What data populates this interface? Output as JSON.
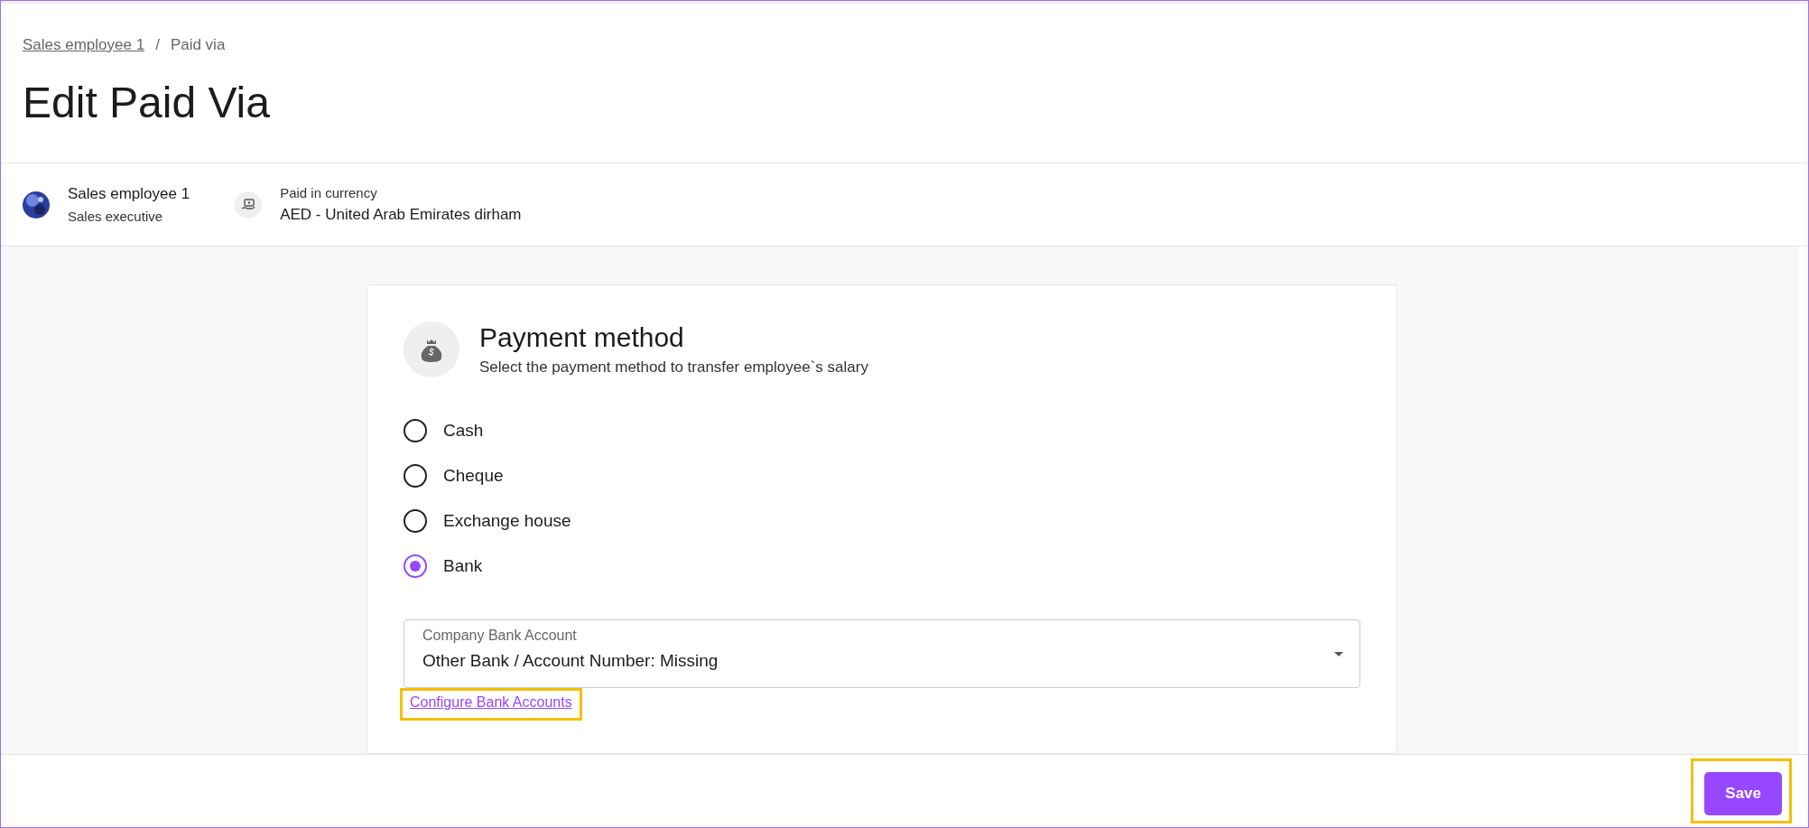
{
  "breadcrumb": [
    {
      "label": "Sales employee 1",
      "kind": "link"
    },
    {
      "label": "/",
      "kind": "separator"
    },
    {
      "label": "Paid via",
      "kind": "current"
    }
  ],
  "title": "Edit Paid Via",
  "employee": {
    "name": "Sales employee 1",
    "role": "Sales executive"
  },
  "currency": {
    "label": "Paid in currency",
    "value": "AED - United Arab Emirates dirham"
  },
  "payment_method": {
    "title": "Payment method",
    "subtitle": "Select the payment method to transfer employee`s salary",
    "options": [
      {
        "label": "Cash",
        "selected": false
      },
      {
        "label": "Cheque",
        "selected": false
      },
      {
        "label": "Exchange house",
        "selected": false
      },
      {
        "label": "Bank",
        "selected": true
      }
    ],
    "bank_account": {
      "label": "Company Bank Account",
      "value": "Other Bank / Account Number: Missing"
    },
    "configure_link": {
      "label": "Configure Bank Accounts",
      "highlighted": true
    }
  },
  "save_button": {
    "label": "Save",
    "highlighted": true
  }
}
